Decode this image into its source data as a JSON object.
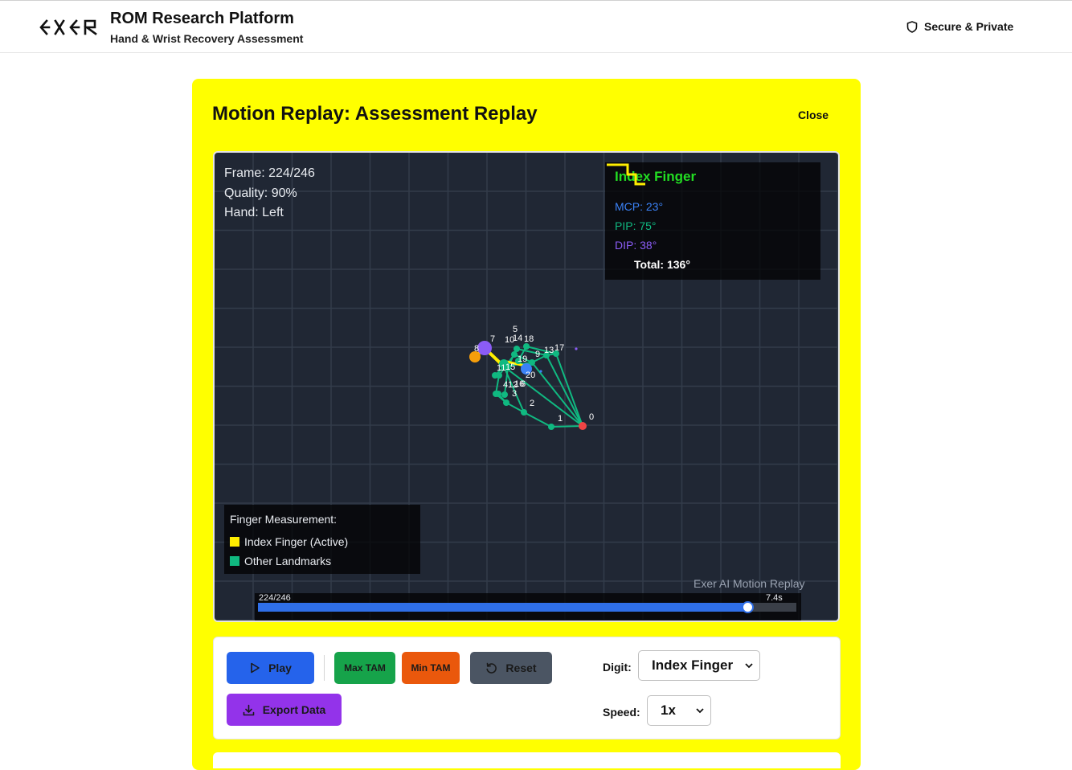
{
  "header": {
    "logo_text": "EXER",
    "title": "ROM Research Platform",
    "subtitle": "Hand & Wrist Recovery Assessment",
    "secure_label": "Secure & Private"
  },
  "card": {
    "title": "Motion Replay: Assessment Replay",
    "close_label": "Close"
  },
  "replay": {
    "frame_text": "Frame: 224/246",
    "quality_text": "Quality: 90%",
    "hand_text": "Hand: Left",
    "frame_current": 224,
    "frame_total": 246,
    "watermark": "Exer AI Motion Replay"
  },
  "finger_info": {
    "title": "Index Finger",
    "mcp": "MCP: 23°",
    "pip": "PIP: 75°",
    "dip": "DIP: 38°",
    "total": "Total: 136°"
  },
  "legend": {
    "title": "Finger Measurement:",
    "items": [
      {
        "label": "Index Finger (Active)",
        "color": "#ffee00"
      },
      {
        "label": "Other Landmarks",
        "color": "#10b981"
      }
    ]
  },
  "timeline": {
    "position_label": "224/246",
    "time_label": "7.4s",
    "progress": 0.9106
  },
  "controls": {
    "play_label": "Play",
    "max_tam_label": "Max TAM",
    "min_tam_label": "Min TAM",
    "reset_label": "Reset",
    "export_label": "Export Data",
    "digit_label": "Digit:",
    "digit_value": "Index Finger",
    "speed_label": "Speed:",
    "speed_value": "1x"
  },
  "colors": {
    "card_bg": "#ffff00",
    "canvas_bg": "#202734",
    "landmark": "#10b981",
    "active_finger": "#ffee00",
    "wrist": "#ef4444",
    "tip": "#f59e0b",
    "dip": "#8b5cf6",
    "mcp": "#3b82f6"
  },
  "landmark_labels": [
    "0",
    "1",
    "2",
    "3",
    "4",
    "5",
    "6",
    "7",
    "8",
    "9",
    "10",
    "11",
    "12",
    "13",
    "14",
    "15",
    "16",
    "17",
    "18",
    "19",
    "20"
  ]
}
